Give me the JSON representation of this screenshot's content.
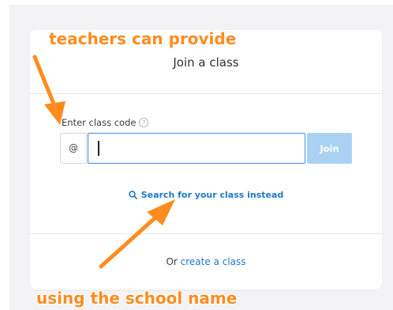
{
  "card": {
    "title": "Join a class",
    "code_label": "Enter class code",
    "help_glyph": "?",
    "at_prefix": "@",
    "code_value": "",
    "join_label": "Join",
    "search_link": "Search for your class instead",
    "or_text": "Or ",
    "create_link": "create a class"
  },
  "annotations": {
    "top": "teachers can provide",
    "bottom": "using the school name"
  },
  "colors": {
    "accent": "#1f78c8",
    "input_focus": "#3a8ee6",
    "join_disabled": "#a9d1f2",
    "annotation": "#ff8c1f",
    "backdrop": "#f3f3f5"
  },
  "icons": [
    "help-icon",
    "search-icon",
    "arrow-icon"
  ]
}
